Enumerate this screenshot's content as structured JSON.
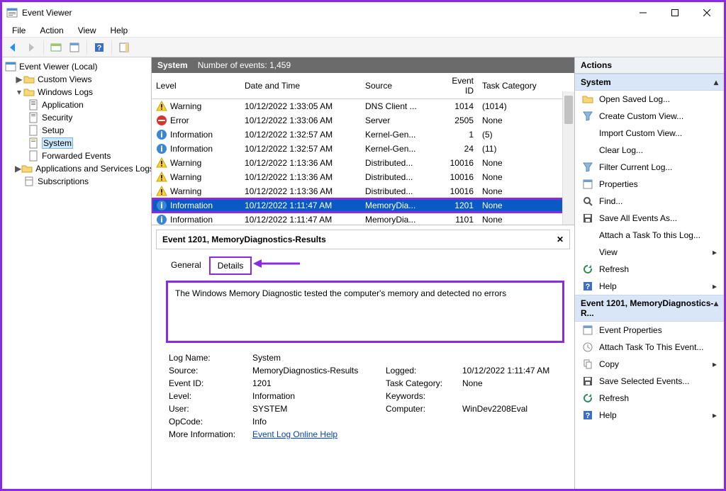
{
  "titlebar": {
    "title": "Event Viewer"
  },
  "menubar": {
    "file": "File",
    "action": "Action",
    "view": "View",
    "help": "Help"
  },
  "tree": {
    "root": "Event Viewer (Local)",
    "custom_views": "Custom Views",
    "windows_logs": "Windows Logs",
    "application": "Application",
    "security": "Security",
    "setup": "Setup",
    "system": "System",
    "forwarded": "Forwarded Events",
    "apps_services": "Applications and Services Logs",
    "subscriptions": "Subscriptions"
  },
  "midheader": {
    "log": "System",
    "count_label": "Number of events: 1,459"
  },
  "columns": {
    "level": "Level",
    "date": "Date and Time",
    "source": "Source",
    "eventid": "Event ID",
    "task": "Task Category"
  },
  "events": [
    {
      "level": "Warning",
      "date": "10/12/2022 1:33:05 AM",
      "source": "DNS Client ...",
      "id": "1014",
      "task": "(1014)"
    },
    {
      "level": "Error",
      "date": "10/12/2022 1:33:06 AM",
      "source": "Server",
      "id": "2505",
      "task": "None"
    },
    {
      "level": "Information",
      "date": "10/12/2022 1:32:57 AM",
      "source": "Kernel-Gen...",
      "id": "1",
      "task": "(5)"
    },
    {
      "level": "Information",
      "date": "10/12/2022 1:32:57 AM",
      "source": "Kernel-Gen...",
      "id": "24",
      "task": "(11)"
    },
    {
      "level": "Warning",
      "date": "10/12/2022 1:13:36 AM",
      "source": "Distributed...",
      "id": "10016",
      "task": "None"
    },
    {
      "level": "Warning",
      "date": "10/12/2022 1:13:36 AM",
      "source": "Distributed...",
      "id": "10016",
      "task": "None"
    },
    {
      "level": "Warning",
      "date": "10/12/2022 1:13:36 AM",
      "source": "Distributed...",
      "id": "10016",
      "task": "None"
    },
    {
      "level": "Information",
      "date": "10/12/2022 1:11:47 AM",
      "source": "MemoryDia...",
      "id": "1201",
      "task": "None"
    },
    {
      "level": "Information",
      "date": "10/12/2022 1:11:47 AM",
      "source": "MemoryDia...",
      "id": "1101",
      "task": "None"
    }
  ],
  "detail": {
    "header": "Event 1201, MemoryDiagnostics-Results",
    "tab_general": "General",
    "tab_details": "Details",
    "description": "The Windows Memory Diagnostic tested the computer's memory and detected no errors",
    "labels": {
      "logname": "Log Name:",
      "source": "Source:",
      "eventid": "Event ID:",
      "level": "Level:",
      "user": "User:",
      "opcode": "OpCode:",
      "moreinfo": "More Information:",
      "logged": "Logged:",
      "task": "Task Category:",
      "keywords": "Keywords:",
      "computer": "Computer:"
    },
    "values": {
      "logname": "System",
      "source": "MemoryDiagnostics-Results",
      "eventid": "1201",
      "level": "Information",
      "user": "SYSTEM",
      "opcode": "Info",
      "moreinfo": "Event Log Online Help",
      "logged": "10/12/2022 1:11:47 AM",
      "task": "None",
      "keywords": "",
      "computer": "WinDev2208Eval"
    }
  },
  "actions": {
    "header": "Actions",
    "group1": "System",
    "open_saved": "Open Saved Log...",
    "create_custom": "Create Custom View...",
    "import_custom": "Import Custom View...",
    "clear_log": "Clear Log...",
    "filter_log": "Filter Current Log...",
    "properties": "Properties",
    "find": "Find...",
    "save_all": "Save All Events As...",
    "attach_task_log": "Attach a Task To this Log...",
    "view": "View",
    "refresh": "Refresh",
    "help": "Help",
    "group2": "Event 1201, MemoryDiagnostics-R...",
    "event_props": "Event Properties",
    "attach_task_event": "Attach Task To This Event...",
    "copy": "Copy",
    "save_selected": "Save Selected Events...",
    "refresh2": "Refresh",
    "help2": "Help"
  }
}
